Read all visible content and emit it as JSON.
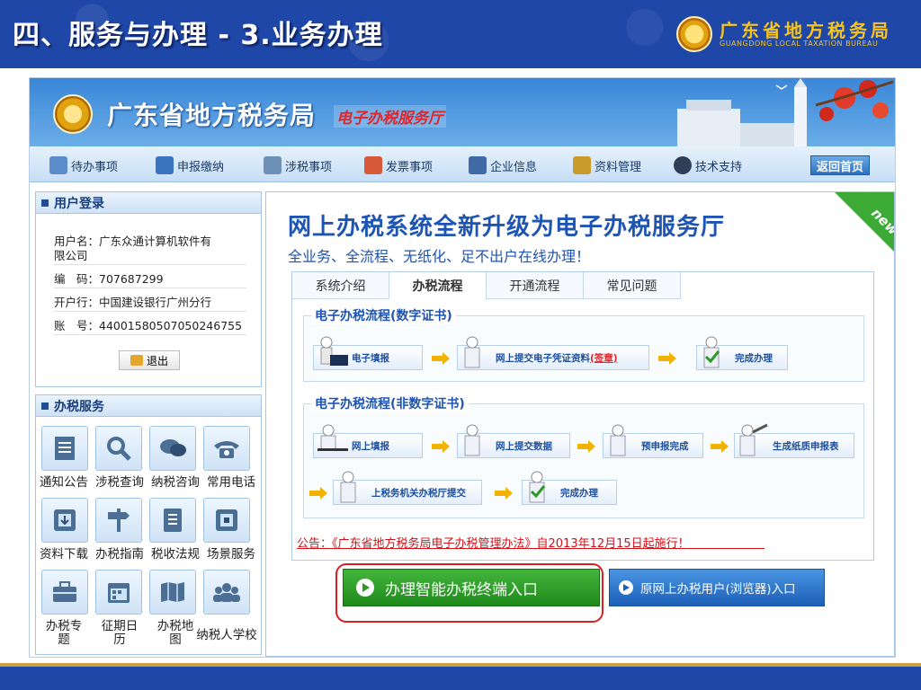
{
  "slide": {
    "title": "四、服务与办理 - 3.业务办理",
    "bureau_name": "广东省地方税务局",
    "bureau_name_en": "GUANGDONG LOCAL TAXATION BUREAU"
  },
  "banner": {
    "title": "广东省地方税务局",
    "subtitle": "电子办税服务厅"
  },
  "nav": {
    "items": [
      "待办事项",
      "申报缴纳",
      "涉税事项",
      "发票事项",
      "企业信息",
      "资料管理",
      "技术支持"
    ],
    "home": "返回首页"
  },
  "login": {
    "heading": "用户登录",
    "name_line1": "用户名：广东众通计算机软件有",
    "name_line2": "限公司",
    "code": "编　码：707687299",
    "bank": "开户行：中国建设银行广州分行",
    "account": "账　号：44001580507050246755",
    "logout": "退出"
  },
  "services": {
    "heading": "办税服务",
    "row1": [
      "通知公告",
      "涉税查询",
      "纳税咨询",
      "常用电话"
    ],
    "row2": [
      "资料下载",
      "办税指南",
      "税收法规",
      "场景服务"
    ],
    "row3a": "办税专",
    "row3a2": "题",
    "row3b": "征期日",
    "row3b2": "历",
    "row3c": "办税地",
    "row3c2": "图",
    "row3d": "纳税人学校"
  },
  "main": {
    "title": "网上办税系统全新升级为电子办税服务厅",
    "subtitle": "全业务、全流程、无纸化、足不出户在线办理！",
    "new_badge": "new",
    "tabs": [
      "系统介绍",
      "办税流程",
      "开通流程",
      "常见问题"
    ],
    "flow1": {
      "title": "电子办税流程(数字证书)",
      "steps": [
        "电子填报",
        "网上提交电子凭证资料",
        "(签章)",
        "完成办理"
      ]
    },
    "flow2": {
      "title": "电子办税流程(非数字证书)",
      "steps": [
        "网上填报",
        "网上提交数据",
        "预申报完成",
        "生成纸质申报表",
        "上税务机关办税厅提交",
        "完成办理"
      ]
    },
    "notice": "公告：《广东省地方税务局电子办税管理办法》自2013年12月15日起施行！"
  },
  "buttons": {
    "smart_terminal": "办理智能办税终端入口",
    "browser_entry": "原网上办税用户(浏览器)入口"
  },
  "colors": {
    "slide_blue": "#1f47a8",
    "brand_blue": "#1e55b3",
    "accent_red": "#d81f26",
    "button_green": "#2a9a25"
  }
}
